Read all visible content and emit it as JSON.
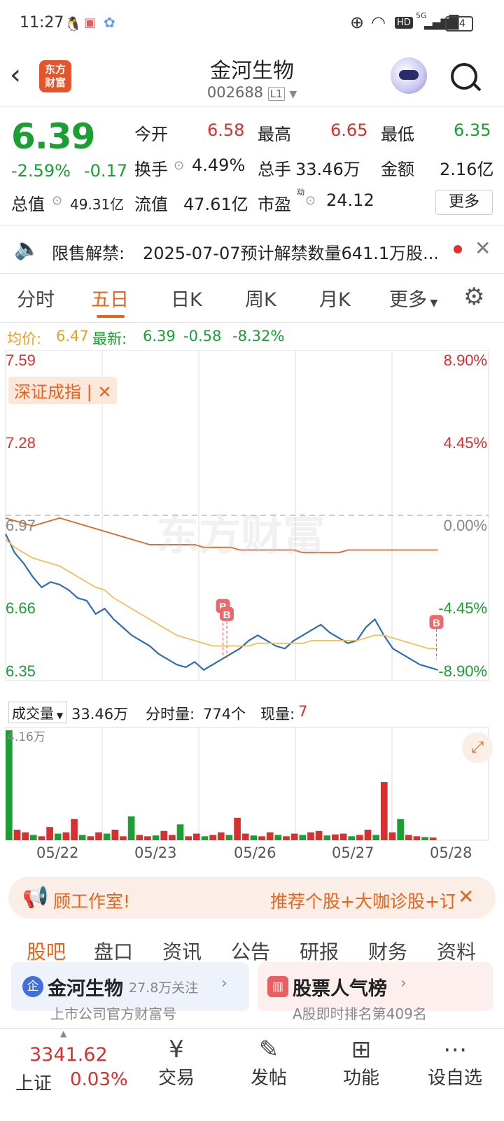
{
  "status_bar": {
    "time": "11:27",
    "battery": "94",
    "network": "5G"
  },
  "header": {
    "title": "金河生物",
    "code": "002688",
    "level": "L1",
    "logo_text_1": "东方",
    "logo_text_2": "财富"
  },
  "quote": {
    "price": "6.39",
    "change_pct": "-2.59%",
    "change": "-0.17",
    "open_label": "今开",
    "open": "6.58",
    "high_label": "最高",
    "high": "6.65",
    "low_label": "最低",
    "low": "6.35",
    "turnover_label": "换手",
    "turnover": "4.49%",
    "volume_label": "总手",
    "volume": "33.46万",
    "amount_label": "金额",
    "amount": "2.16亿",
    "mcap_label": "总值",
    "mcap": "49.31亿",
    "float_label": "流值",
    "float": "47.61亿",
    "pe_label": "市盈",
    "pe_sup": "动",
    "pe": "24.12",
    "more": "更多"
  },
  "notice": {
    "label": "限售解禁:",
    "text": "2025-07-07预计解禁数量641.1万股..."
  },
  "chart_tabs": [
    "分时",
    "五日",
    "日K",
    "周K",
    "月K",
    "更多"
  ],
  "chart_legend": {
    "avg_label": "均价:",
    "avg": "6.47",
    "latest_label": "最新:",
    "latest": "6.39",
    "chg": "-0.58",
    "chg_pct": "-8.32%"
  },
  "chart_data": {
    "type": "line",
    "x_dates": [
      "05/22",
      "05/23",
      "05/26",
      "05/27",
      "05/28"
    ],
    "y_ticks_left": [
      "7.59",
      "7.28",
      "6.97",
      "6.66",
      "6.35"
    ],
    "y_ticks_right": [
      "8.90%",
      "4.45%",
      "0.00%",
      "-4.45%",
      "-8.90%"
    ],
    "ylim": [
      6.35,
      7.59
    ],
    "prev_close": 6.97,
    "overlay_tag": "深证成指",
    "watermark": "东方财富",
    "series": [
      {
        "color": "#2e6db4",
        "values": [
          6.9,
          6.83,
          6.79,
          6.74,
          6.7,
          6.72,
          6.71,
          6.69,
          6.66,
          6.65,
          6.6,
          6.62,
          6.58,
          6.55,
          6.52,
          6.5,
          6.48,
          6.45,
          6.43,
          6.41,
          6.4,
          6.42,
          6.39,
          6.41,
          6.43,
          6.45,
          6.47,
          6.5,
          6.52,
          6.5,
          6.48,
          6.47,
          6.5,
          6.52,
          6.54,
          6.56,
          6.53,
          6.51,
          6.49,
          6.5,
          6.55,
          6.58,
          6.52,
          6.47,
          6.45,
          6.43,
          6.41,
          6.4,
          6.39
        ]
      },
      {
        "color": "#f0c060",
        "values": [
          6.88,
          6.85,
          6.83,
          6.81,
          6.8,
          6.79,
          6.78,
          6.76,
          6.74,
          6.72,
          6.7,
          6.69,
          6.66,
          6.64,
          6.62,
          6.6,
          6.58,
          6.56,
          6.54,
          6.52,
          6.51,
          6.5,
          6.49,
          6.48,
          6.48,
          6.48,
          6.48,
          6.48,
          6.49,
          6.49,
          6.49,
          6.49,
          6.49,
          6.49,
          6.5,
          6.5,
          6.5,
          6.5,
          6.5,
          6.5,
          6.51,
          6.52,
          6.52,
          6.51,
          6.5,
          6.49,
          6.48,
          6.47,
          6.47
        ]
      },
      {
        "color": "#d8672a",
        "values": [
          6.96,
          6.95,
          6.94,
          6.93,
          6.94,
          6.95,
          6.96,
          6.95,
          6.94,
          6.93,
          6.92,
          6.91,
          6.9,
          6.89,
          6.88,
          6.87,
          6.86,
          6.86,
          6.86,
          6.86,
          6.86,
          6.86,
          6.85,
          6.85,
          6.85,
          6.85,
          6.84,
          6.84,
          6.84,
          6.84,
          6.84,
          6.84,
          6.84,
          6.83,
          6.83,
          6.83,
          6.83,
          6.83,
          6.84,
          6.84,
          6.84,
          6.84,
          6.84,
          6.84,
          6.84,
          6.84,
          6.84,
          6.84,
          6.84
        ]
      }
    ],
    "buy_markers": [
      "B",
      "B",
      "B"
    ],
    "volume_values": [
      41600,
      4000,
      3000,
      2000,
      1500,
      5000,
      2500,
      3000,
      8000,
      2000,
      1500,
      3000,
      2500,
      4000,
      1500,
      9000,
      2000,
      1500,
      1800,
      3500,
      2000,
      6000,
      1500,
      2500,
      1500,
      2000,
      3000,
      2000,
      8500,
      2500,
      1800,
      1500,
      3000,
      2000,
      1500,
      2500,
      2000,
      3000,
      3500,
      1800,
      2200,
      2500,
      1500,
      2000,
      4000,
      2000,
      22000,
      3000,
      8000,
      2000,
      1500,
      1200,
      1000
    ]
  },
  "volume_bar": {
    "label": "成交量",
    "total": "33.46万",
    "tick_label": "分时量:",
    "tick_value": "774个",
    "now_label": "现量:",
    "now_value": "7",
    "max_label": "4.16万"
  },
  "banner": {
    "left": "顾工作室!",
    "right": "推荐个股+大咖诊股+订"
  },
  "sub_tabs": [
    "股吧",
    "盘口",
    "资讯",
    "公告",
    "研报",
    "财务",
    "资料"
  ],
  "cards": [
    {
      "title": "金河生物",
      "followers": "27.8万关注",
      "sub": "上市公司官方财富号",
      "badge": "企"
    },
    {
      "title": "股票人气榜",
      "sub": "A股即时排名第409名"
    }
  ],
  "bottom_nav": {
    "index_value": "3341.62",
    "index_name": "上证",
    "index_chg": "0.03%",
    "items": [
      "交易",
      "发帖",
      "功能",
      "设自选"
    ]
  }
}
